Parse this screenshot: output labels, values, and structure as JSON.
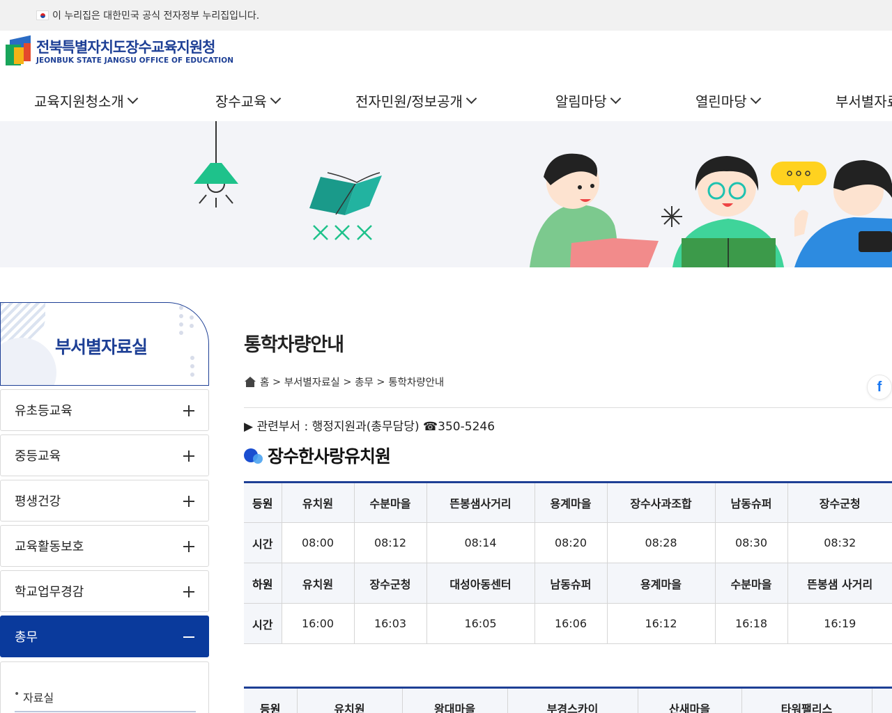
{
  "gov_notice": "이 누리집은 대한민국 공식 전자정부 누리집입니다.",
  "logo": {
    "name_ko": "전북특별자치도장수교육지원청",
    "name_en": "JEONBUK STATE JANGSU OFFICE OF EDUCATION"
  },
  "nav": [
    {
      "label": "교육지원청소개"
    },
    {
      "label": "장수교육"
    },
    {
      "label": "전자민원/정보공개"
    },
    {
      "label": "알림마당"
    },
    {
      "label": "열린마당"
    },
    {
      "label": "부서별자료실"
    }
  ],
  "sidebar": {
    "title": "부서별자료실",
    "items": [
      {
        "label": "유초등교육"
      },
      {
        "label": "중등교육"
      },
      {
        "label": "평생건강"
      },
      {
        "label": "교육활동보호"
      },
      {
        "label": "학교업무경감"
      },
      {
        "label": "총무"
      }
    ],
    "sub_items": [
      {
        "label": "자료실"
      }
    ]
  },
  "page": {
    "title": "통학차량안내",
    "breadcrumb": [
      "홈",
      "부서별자료실",
      "총무",
      "통학차량안내"
    ],
    "dept": "▶ 관련부서 : 행정지원과(총무담당) ☎350-5246",
    "section_title": "장수한사랑유치원"
  },
  "table1": {
    "rows": [
      [
        "등원",
        "유치원",
        "수분마을",
        "뜬봉샘사거리",
        "용계마을",
        "장수사과조합",
        "남동슈퍼",
        "장수군청"
      ],
      [
        "시간",
        "08:00",
        "08:12",
        "08:14",
        "08:20",
        "08:28",
        "08:30",
        "08:32"
      ],
      [
        "하원",
        "유치원",
        "장수군청",
        "대성아동센터",
        "남동슈퍼",
        "용계마을",
        "수분마을",
        "뜬봉샘 사거리"
      ],
      [
        "시간",
        "16:00",
        "16:03",
        "16:05",
        "16:06",
        "16:12",
        "16:18",
        "16:19"
      ]
    ]
  },
  "table2": {
    "rows": [
      [
        "등원",
        "유치원",
        "왕대마을",
        "부경스카이",
        "산새마을",
        "타워팰리스",
        ""
      ]
    ]
  },
  "colors": {
    "brand": "#1d3f95",
    "active_menu": "#0a3a9c",
    "facebook": "#1877f2"
  }
}
